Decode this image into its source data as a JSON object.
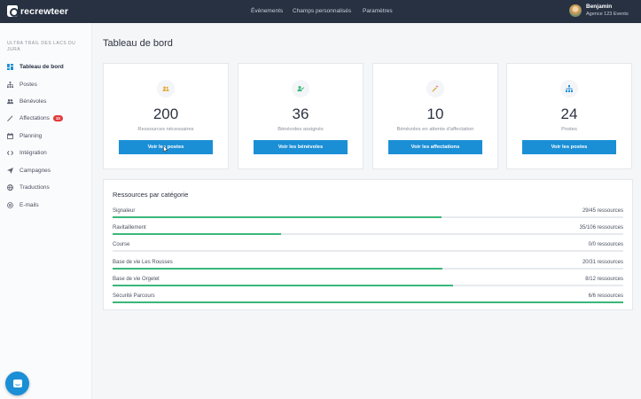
{
  "brand": {
    "name": "recrewteer"
  },
  "nav": {
    "items": [
      "Évènements",
      "Champs personnalisés",
      "Paramètres"
    ]
  },
  "user": {
    "name": "Benjamin",
    "org": "Agence 123 Events"
  },
  "sidebar": {
    "event_title": "ULTRA TRAIL DES LACS DU JURA",
    "items": [
      {
        "label": "Tableau de bord",
        "icon": "dashboard-icon",
        "active": true
      },
      {
        "label": "Postes",
        "icon": "org-chart-icon"
      },
      {
        "label": "Bénévoles",
        "icon": "users-icon"
      },
      {
        "label": "Affectations",
        "icon": "wand-icon",
        "badge": "10"
      },
      {
        "label": "Planning",
        "icon": "calendar-icon"
      },
      {
        "label": "Intégration",
        "icon": "code-icon"
      },
      {
        "label": "Campagnes",
        "icon": "send-icon"
      },
      {
        "label": "Traductions",
        "icon": "globe-icon"
      },
      {
        "label": "E-mails",
        "icon": "at-icon"
      }
    ]
  },
  "page": {
    "title": "Tableau de bord"
  },
  "cards": [
    {
      "value": "200",
      "label": "Ressources nécessaires",
      "button": "Voir les postes",
      "icon": "users-icon"
    },
    {
      "value": "36",
      "label": "Bénévoles assignés",
      "button": "Voir les bénévoles",
      "icon": "user-check-icon"
    },
    {
      "value": "10",
      "label": "Bénévoles en attente d'affectation",
      "button": "Voir les affectations",
      "icon": "wand-icon"
    },
    {
      "value": "24",
      "label": "Postes",
      "button": "Voir les postes",
      "icon": "org-chart-icon"
    }
  ],
  "categories": {
    "title": "Ressources par catégorie",
    "rows": [
      {
        "name": "Signaleur",
        "value": "29/45 ressources",
        "fraction": 0.644
      },
      {
        "name": "Ravitaillement",
        "value": "35/106 ressources",
        "fraction": 0.33
      },
      {
        "name": "Course",
        "value": "0/0 ressources",
        "fraction": 0
      },
      {
        "name": "Base de vie Les Rousses",
        "value": "20/31 ressources",
        "fraction": 0.645
      },
      {
        "name": "Base de vie Orgelet",
        "value": "8/12 ressources",
        "fraction": 0.667
      },
      {
        "name": "Sécurité Parcours",
        "value": "6/6 ressources",
        "fraction": 1.0
      }
    ]
  },
  "colors": {
    "topbar": "#273142",
    "primary": "#1b8fd6",
    "progress": "#3ab77a",
    "badge": "#e03b3b"
  }
}
